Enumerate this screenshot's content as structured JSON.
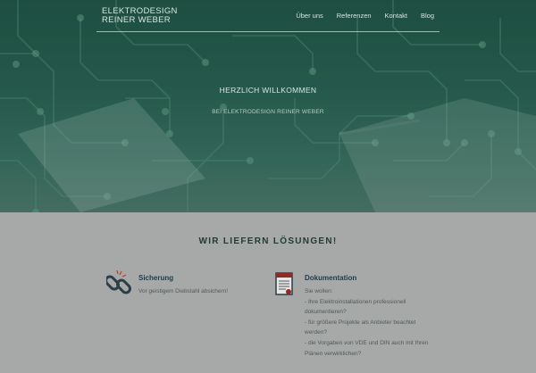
{
  "header": {
    "brand_line1": "ELEKTRODESIGN",
    "brand_line2": "REINER WEBER",
    "nav": [
      {
        "label": "Über uns"
      },
      {
        "label": "Referenzen"
      },
      {
        "label": "Kontakt"
      },
      {
        "label": "Blog"
      }
    ]
  },
  "hero": {
    "title": "HERZLICH WILLKOMMEN",
    "subtitle": "BEI ELEKTRODESIGN REINER WEBER"
  },
  "services": {
    "title": "WIR LIEFERN LÖSUNGEN!",
    "items": [
      {
        "icon": "broken-chain-icon",
        "title": "Sicherung",
        "text": "Vor geistigem Diebstahl absichern!"
      },
      {
        "icon": "document-icon",
        "title": "Dokumentation",
        "lines": [
          "Sie wollen:",
          "- Ihre Elektroinstallationen professionell dokumentieren?",
          "- für größere Projekte als Anbieter beachtet werden?",
          "- die Vorgaben von VDE und DIN auch mit Ihren Plänen verwirklichen?"
        ]
      }
    ]
  },
  "colors": {
    "hero_green": "#2a6152",
    "page_gray": "#a7a8a8",
    "heading_dark": "#213c36",
    "feature_title": "#1e3d4d"
  }
}
